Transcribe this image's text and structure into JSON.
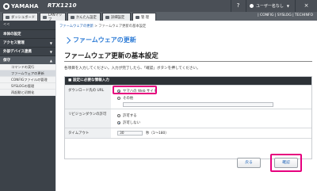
{
  "header": {
    "brand": "YAMAHA",
    "model": "RTX1210",
    "help": "?",
    "user": "ユーザー名なし",
    "close": "×"
  },
  "tabs": [
    {
      "label": "ダッシュボード"
    },
    {
      "label": "LANマップ"
    },
    {
      "label": "かんたん設定"
    },
    {
      "label": "詳細設定"
    },
    {
      "label": "管 理"
    }
  ],
  "tab_links": "| CONFIG | SYSLOG | TECHINFO",
  "sidebar": {
    "toggle": "<<",
    "items": [
      {
        "label": "本体の設定"
      },
      {
        "label": "アクセス管理"
      },
      {
        "label": "外部デバイス連携"
      },
      {
        "label": "保守"
      }
    ],
    "subitems": [
      {
        "label": "コマンドの実行"
      },
      {
        "label": "ファームウェアの更新"
      },
      {
        "label": "CONFIGファイルの管理"
      },
      {
        "label": "SYSLOGの管理"
      },
      {
        "label": "再起動と初期化"
      }
    ]
  },
  "breadcrumb": {
    "link": "ファームウェアの更新",
    "sep": " > ",
    "current": "ファームウェア更新の基本設定"
  },
  "page_title": "ファームウェアの更新",
  "section_title": "ファームウェア更新の基本設定",
  "instruction": "各項目を入力してください。入力が完了したら、「確認」ボタンを押してください。",
  "form_header": "■ 設定に必要な情報入力",
  "form": {
    "download_label": "ダウンロード先の URL",
    "download_opt1": "ヤマハの Web サイト",
    "download_opt2": "その他",
    "download_other_value": "",
    "revision_label": "リビジョンダウンの許可",
    "revision_opt1": "許可する",
    "revision_opt2": "許可しない",
    "timeout_label": "タイムアウト",
    "timeout_value": "30",
    "timeout_unit": "秒（1〜180）"
  },
  "buttons": {
    "back": "戻る",
    "confirm": "確認"
  }
}
